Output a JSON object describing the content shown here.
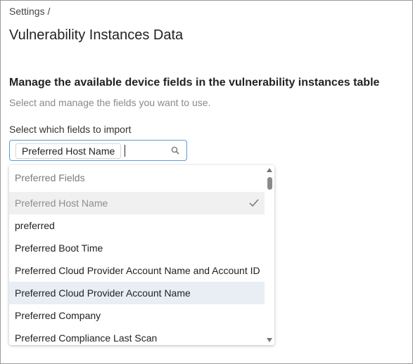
{
  "breadcrumb": "Settings /",
  "page_title": "Vulnerability Instances Data",
  "section": {
    "title": "Manage the available device fields in the vulnerability instances table",
    "subtitle": "Select and manage the fields you want to use."
  },
  "import": {
    "label": "Select which fields to import",
    "selected_chip": "Preferred Host Name",
    "search_value": ""
  },
  "dropdown": {
    "group_label": "Preferred Fields",
    "options": [
      {
        "label": "Preferred Host Name",
        "state": "selected"
      },
      {
        "label": "preferred",
        "state": "normal"
      },
      {
        "label": "Preferred Boot Time",
        "state": "normal"
      },
      {
        "label": "Preferred Cloud Provider Account Name and Account ID",
        "state": "normal"
      },
      {
        "label": "Preferred Cloud Provider Account Name",
        "state": "hover"
      },
      {
        "label": "Preferred Company",
        "state": "normal"
      },
      {
        "label": "Preferred Compliance Last Scan",
        "state": "normal"
      }
    ]
  },
  "icons": {
    "search": "search-icon",
    "check": "check-icon",
    "scroll_up": "chevron-up-icon",
    "scroll_down": "chevron-down-icon"
  },
  "colors": {
    "focus_border": "#5b9bd5",
    "selected_bg": "#f0f0f0",
    "hover_bg": "#e9eef4"
  }
}
